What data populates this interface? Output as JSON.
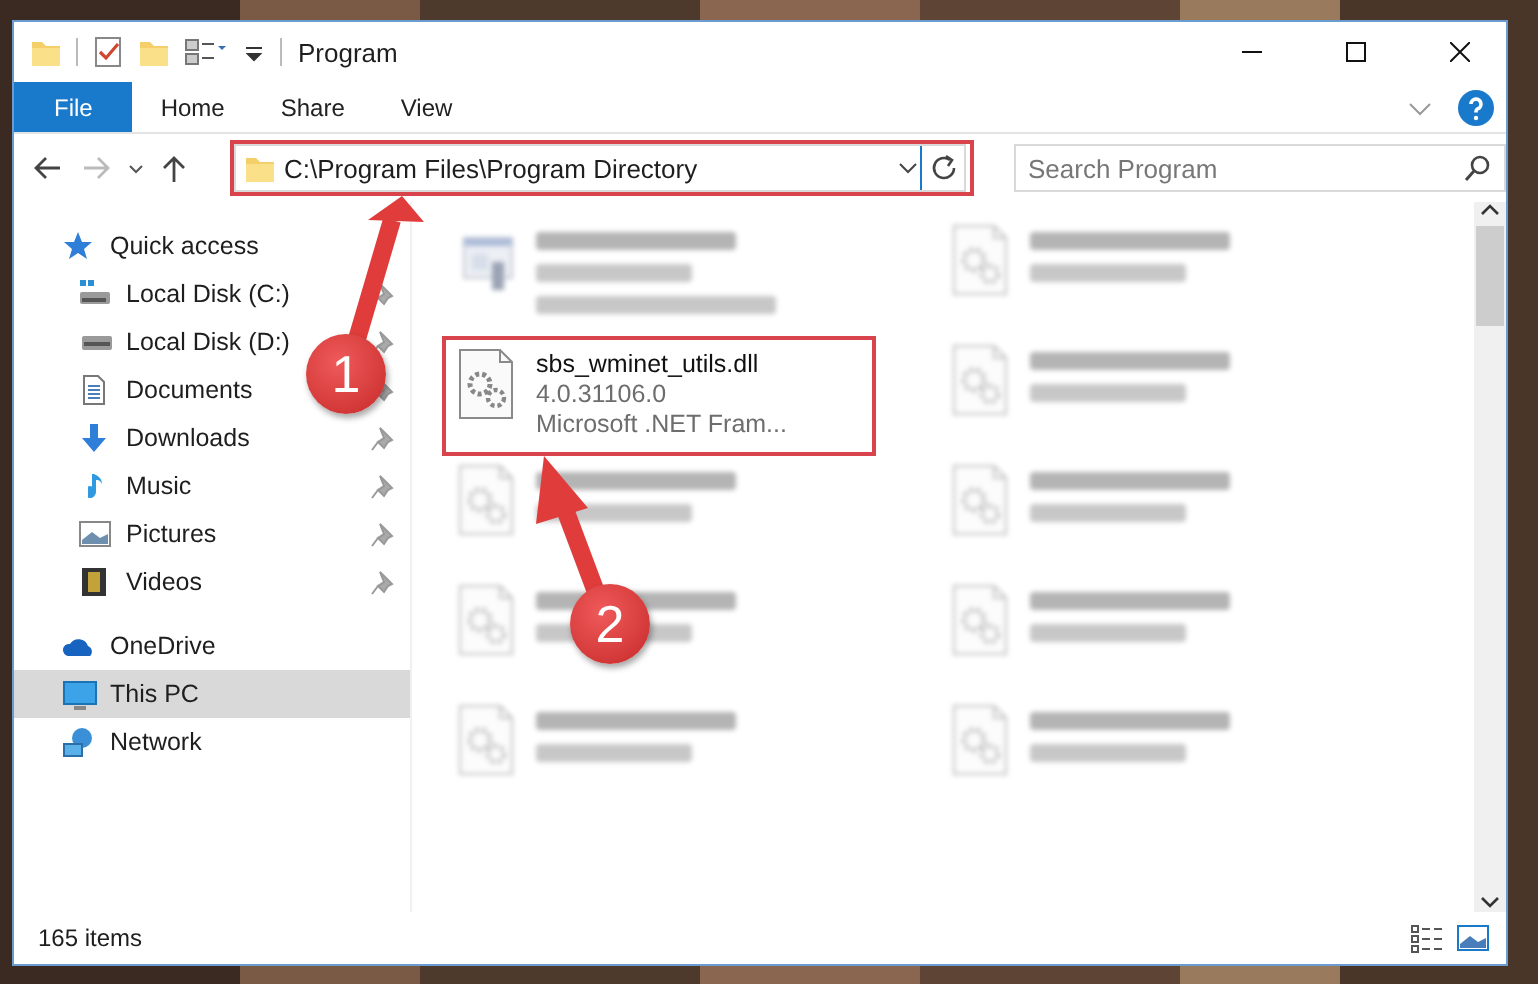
{
  "window": {
    "title": "Program"
  },
  "ribbon_tabs": [
    {
      "label": "File",
      "selected": true
    },
    {
      "label": "Home",
      "selected": false
    },
    {
      "label": "Share",
      "selected": false
    },
    {
      "label": "View",
      "selected": false
    }
  ],
  "address": {
    "value": "C:\\Program Files\\Program Directory"
  },
  "search": {
    "placeholder": "Search Program"
  },
  "sidebar": {
    "items": [
      {
        "label": "Quick access",
        "kind": "star",
        "level_top": true,
        "pinned": false,
        "selected": false
      },
      {
        "label": "Local Disk (C:)",
        "kind": "drive-c",
        "level_top": false,
        "pinned": true,
        "selected": false
      },
      {
        "label": "Local Disk (D:)",
        "kind": "drive",
        "level_top": false,
        "pinned": true,
        "selected": false
      },
      {
        "label": "Documents",
        "kind": "document",
        "level_top": false,
        "pinned": true,
        "selected": false
      },
      {
        "label": "Downloads",
        "kind": "download",
        "level_top": false,
        "pinned": true,
        "selected": false
      },
      {
        "label": "Music",
        "kind": "music",
        "level_top": false,
        "pinned": true,
        "selected": false
      },
      {
        "label": "Pictures",
        "kind": "pictures",
        "level_top": false,
        "pinned": true,
        "selected": false
      },
      {
        "label": "Videos",
        "kind": "video",
        "level_top": false,
        "pinned": true,
        "selected": false
      },
      {
        "label": "OneDrive",
        "kind": "cloud",
        "level_top": true,
        "pinned": false,
        "selected": false
      },
      {
        "label": "This PC",
        "kind": "pc",
        "level_top": true,
        "pinned": false,
        "selected": true
      },
      {
        "label": "Network",
        "kind": "network",
        "level_top": true,
        "pinned": false,
        "selected": false
      }
    ]
  },
  "files": [
    {
      "kind": "exe",
      "blurred": true,
      "highlighted": false
    },
    {
      "kind": "dll",
      "blurred": true,
      "highlighted": false
    },
    {
      "name": "sbs_wminet_utils.dll",
      "kind": "dll",
      "blurred": false,
      "highlighted": true,
      "lines": [
        "4.0.31106.0",
        "Microsoft .NET Fram..."
      ]
    },
    {
      "kind": "dll",
      "blurred": true,
      "highlighted": false
    },
    {
      "kind": "dll",
      "blurred": true,
      "highlighted": false
    },
    {
      "kind": "dll",
      "blurred": true,
      "highlighted": false
    },
    {
      "kind": "dll",
      "blurred": true,
      "highlighted": false
    },
    {
      "kind": "dll",
      "blurred": true,
      "highlighted": false
    },
    {
      "kind": "dll",
      "blurred": true,
      "highlighted": false
    },
    {
      "kind": "dll",
      "blurred": true,
      "highlighted": false
    }
  ],
  "address_highlighted": true,
  "status_bar": {
    "count": "165 items"
  },
  "annotations": [
    {
      "number": "1"
    },
    {
      "number": "2"
    }
  ]
}
